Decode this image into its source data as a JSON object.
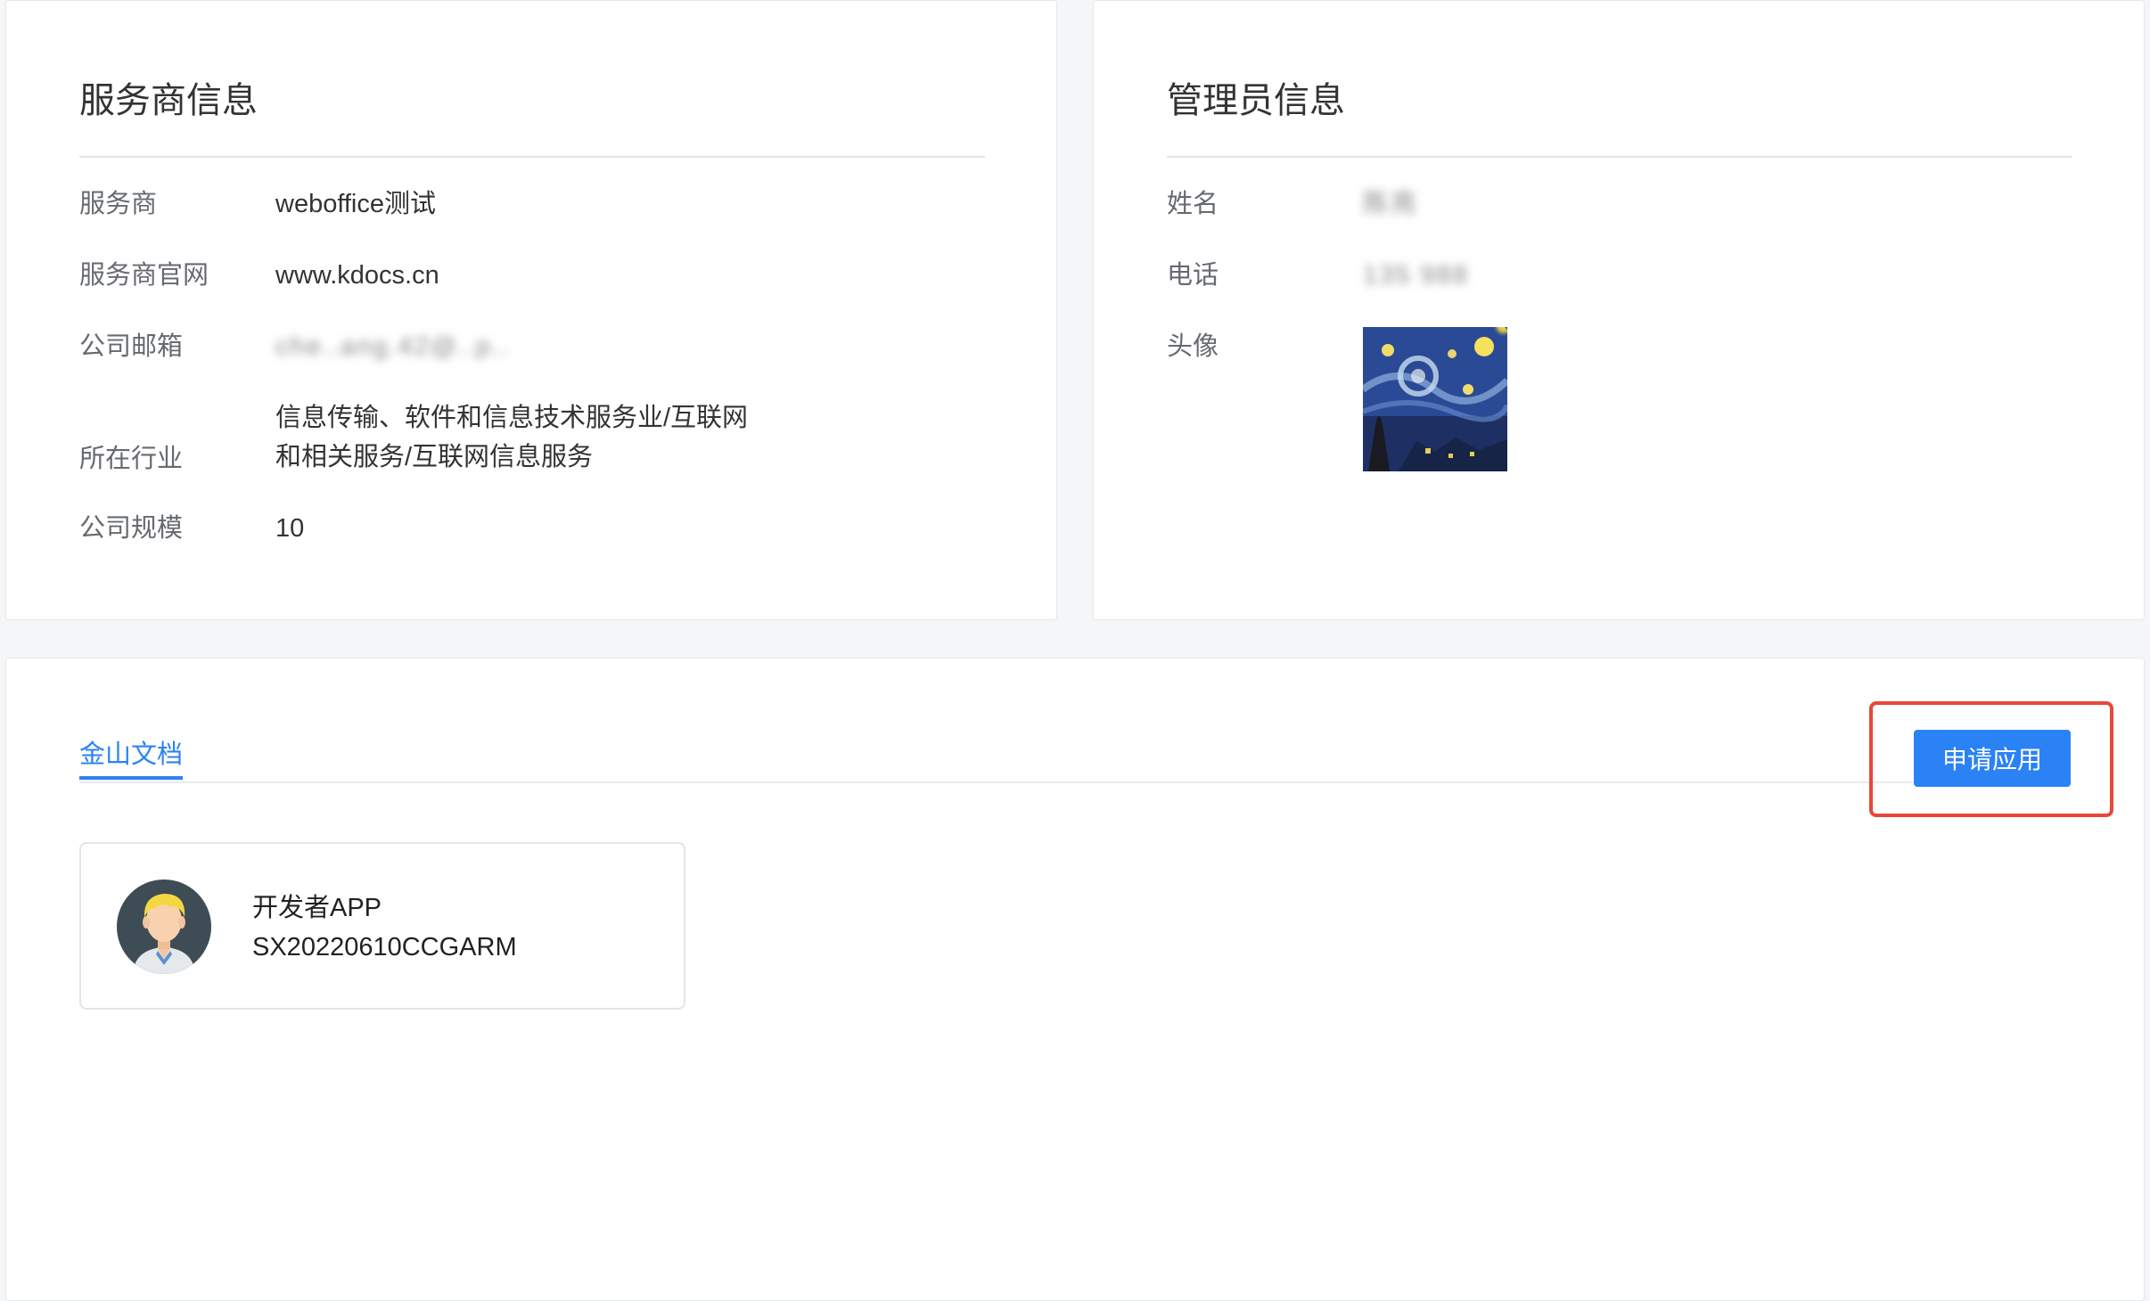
{
  "vendor": {
    "title": "服务商信息",
    "rows": [
      {
        "label": "服务商",
        "value": "weboffice测试"
      },
      {
        "label": "服务商官网",
        "value": "www.kdocs.cn"
      },
      {
        "label": "公司邮箱",
        "value": "che..ang.42@..p.."
      },
      {
        "label": "所在行业",
        "value_line1": "信息传输、软件和信息技术服务业/互联网",
        "value_line2": "和相关服务/互联网信息服务"
      },
      {
        "label": "公司规模",
        "value": "10"
      }
    ]
  },
  "admin": {
    "title": "管理员信息",
    "rows": [
      {
        "label": "姓名",
        "value": "陈亮"
      },
      {
        "label": "电话",
        "value": "135 988"
      },
      {
        "label": "头像"
      }
    ],
    "avatar_icon": "starry-night-avatar-image"
  },
  "apps": {
    "tabs": [
      {
        "label": "金山文档",
        "active": true
      }
    ],
    "apply_button": "申请应用",
    "items": [
      {
        "name": "开发者APP",
        "id": "SX20220610CCGARM",
        "icon": "developer-avatar-icon"
      }
    ]
  },
  "colors": {
    "accent": "#2b82f5",
    "highlight": "#e8473a",
    "background": "#f5f6f8"
  }
}
